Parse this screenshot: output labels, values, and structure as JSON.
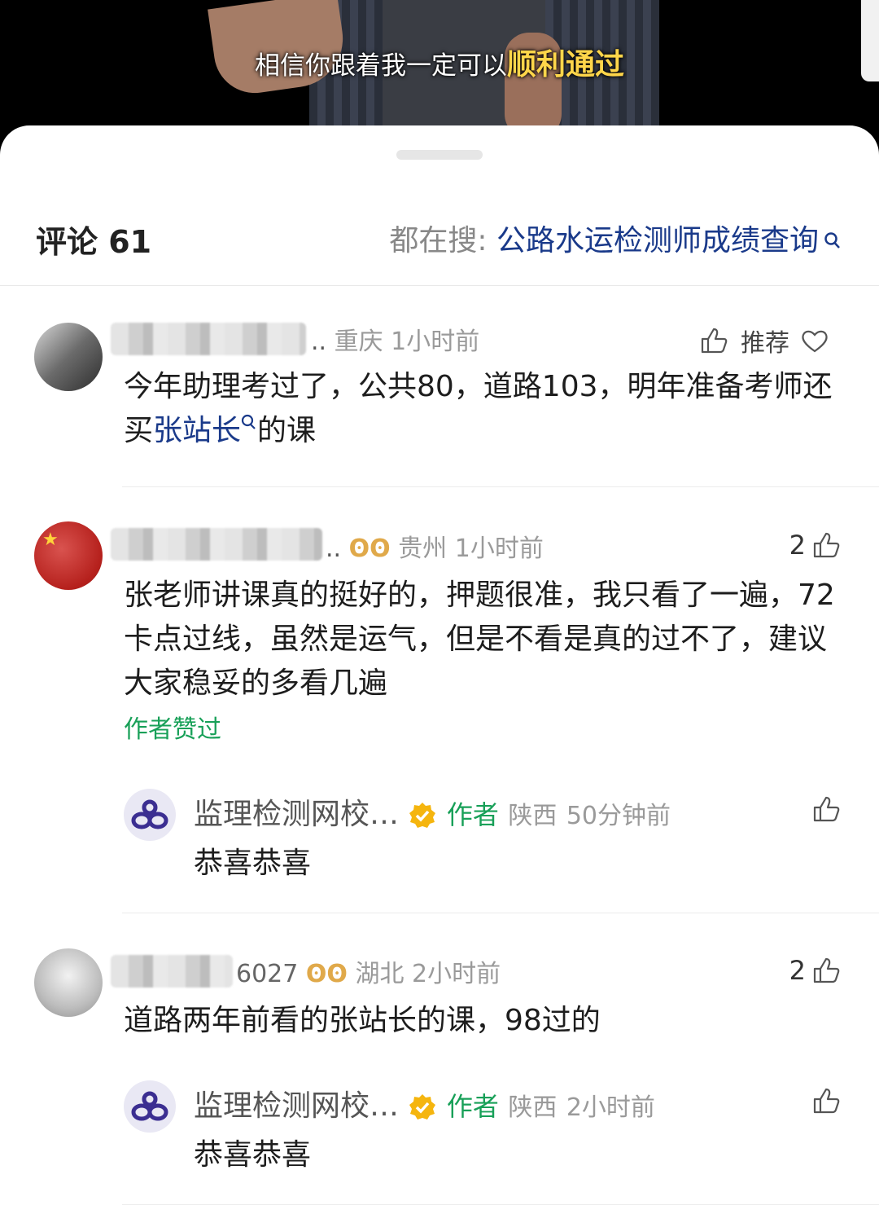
{
  "video": {
    "subtitle_prefix": "相信你跟着我一定可以",
    "subtitle_highlight": "顺利通过"
  },
  "header": {
    "comments_label": "评论 61",
    "search_prefix": "都在搜:",
    "search_keyword": "公路水运检测师成绩查询"
  },
  "comments": [
    {
      "location": "重庆",
      "time": "1小时前",
      "recommend_label": "推荐",
      "text_before": "今年助理考过了，公共80，道路103，明年准备考师还买",
      "text_link": "张站长",
      "text_after": "的课"
    },
    {
      "location": "贵州",
      "time": "1小时前",
      "likes": "2",
      "text": "张老师讲课真的挺好的，押题很准，我只看了一遍，72卡点过线，虽然是运气，但是不看是真的过不了，建议大家稳妥的多看几遍",
      "author_liked": "作者赞过",
      "reply": {
        "name": "监理检测网校…",
        "author_tag": "作者",
        "location": "陕西",
        "time": "50分钟前",
        "text": "恭喜恭喜"
      }
    },
    {
      "location": "湖北",
      "time": "2小时前",
      "likes": "2",
      "name_fragment": "6027",
      "text": "道路两年前看的张站长的课，98过的",
      "reply": {
        "name": "监理检测网校…",
        "author_tag": "作者",
        "location": "陕西",
        "time": "2小时前",
        "text": "恭喜恭喜"
      }
    }
  ]
}
